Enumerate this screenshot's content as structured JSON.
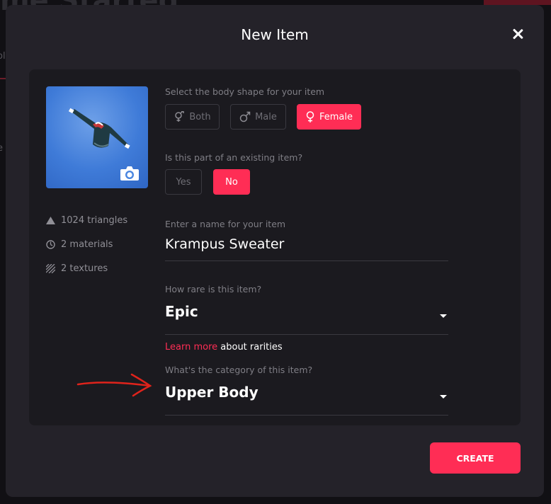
{
  "background": {
    "title": "me Started",
    "side_1": "ol",
    "side_2": "e"
  },
  "modal": {
    "title": "New Item",
    "close_icon": "close-icon",
    "thumbnail": {
      "camera_icon": "camera-icon",
      "preview_icon": "sweater-preview"
    },
    "stats": [
      {
        "icon": "triangle-icon",
        "label": "1024 triangles"
      },
      {
        "icon": "material-icon",
        "label": "2 materials"
      },
      {
        "icon": "texture-icon",
        "label": "2 textures"
      }
    ],
    "body_shape": {
      "label": "Select the body shape for your item",
      "options": [
        "Both",
        "Male",
        "Female"
      ],
      "selected": "Female"
    },
    "existing": {
      "label": "Is this part of an existing item?",
      "options": [
        "Yes",
        "No"
      ],
      "selected": "No"
    },
    "name": {
      "label": "Enter a name for your item",
      "value": "Krampus Sweater"
    },
    "rarity": {
      "label": "How rare is this item?",
      "value": "Epic"
    },
    "learn_more": {
      "link": "Learn more",
      "text": " about rarities"
    },
    "category": {
      "label": "What's the category of this item?",
      "value": "Upper Body"
    },
    "create_label": "CREATE",
    "colors": {
      "accent": "#ff2d55",
      "panel": "#1b1a1f",
      "modal": "#242229",
      "annotation": "#e0231b"
    }
  }
}
